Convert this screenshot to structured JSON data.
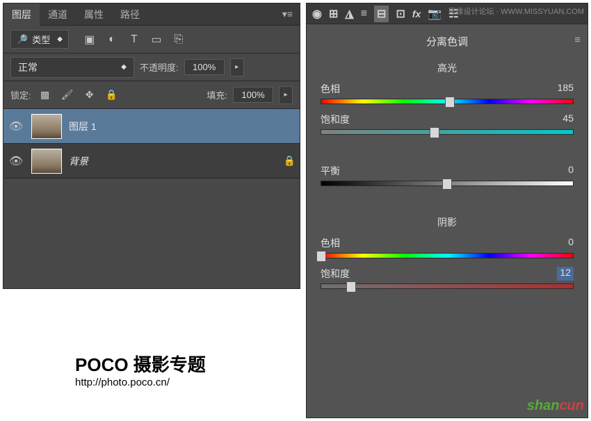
{
  "left": {
    "tabs": [
      "图层",
      "通道",
      "属性",
      "路径"
    ],
    "type_label": "类型",
    "blend_mode": "正常",
    "opacity_label": "不透明度:",
    "opacity_value": "100%",
    "lock_label": "锁定:",
    "fill_label": "填充:",
    "fill_value": "100%",
    "layers": [
      {
        "name": "图层 1",
        "selected": true,
        "locked": false
      },
      {
        "name": "背景",
        "selected": false,
        "locked": true
      }
    ]
  },
  "right": {
    "panel_title": "分离色调",
    "highlights_title": "高光",
    "shadows_title": "阴影",
    "balance_label": "平衡",
    "balance_value": "0",
    "highlights": {
      "hue_label": "色相",
      "hue_value": "185",
      "sat_label": "饱和度",
      "sat_value": "45"
    },
    "shadows": {
      "hue_label": "色相",
      "hue_value": "0",
      "sat_label": "饱和度",
      "sat_value": "12"
    }
  },
  "brand": {
    "title": "POCO 摄影专题",
    "url": "http://photo.poco.cn/"
  },
  "watermark": {
    "top": "思缘设计论坛 · WWW.MISSYUAN.COM",
    "bottom": "shancun"
  }
}
